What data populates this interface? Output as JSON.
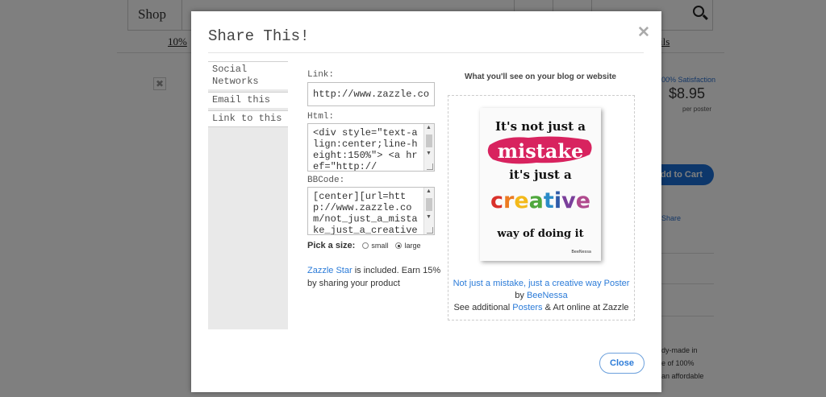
{
  "background": {
    "nav": {
      "shop": "Shop"
    },
    "promo_left": "10%",
    "promo_right": "ils",
    "satisfaction": "00% Satisfaction",
    "price": "$8.95",
    "per_poster": "per poster",
    "add_to_cart": "dd to Cart",
    "share": "Share",
    "desc_lines": [
      "dy-made in",
      "e of 100%",
      "an affordable"
    ],
    "close_glyph": "✖"
  },
  "modal": {
    "title": "Share This!",
    "close_x": "✕",
    "side_nav": [
      "Social Networks",
      "Email this",
      "Link to this"
    ],
    "link_label": "Link:",
    "link_value": "http://www.zazzle.com/",
    "html_label": "Html:",
    "html_value": "<div style=\"text-align:center;line-height:150%\"> <a href=\"http://",
    "bbcode_label": "BBCode:",
    "bbcode_value": "[center][url=http://www.zazzle.com/not_just_a_mistake_just_a_creative",
    "size": {
      "label": "Pick a size:",
      "small": "small",
      "large": "large",
      "selected": "large"
    },
    "star": {
      "link": "Zazzle Star",
      "text": "is included. Earn 15% by sharing your product"
    },
    "preview_heading": "What you'll see on your blog or website",
    "poster": {
      "line1": "It's not just a",
      "line2": "mistake",
      "line3": "it's just a",
      "line4": [
        "c",
        "r",
        "e",
        "a",
        "t",
        "i",
        "v",
        "e"
      ],
      "line5": "way of doing it",
      "signature": "BeeNessa",
      "creative_colors": [
        "#d9312b",
        "#ec7b22",
        "#f3b91a",
        "#4fa83d",
        "#2a8bc8",
        "#2f5aa8",
        "#7a3f9b",
        "#b04a8e"
      ],
      "splash_color": "#d8235f"
    },
    "caption": {
      "product_link": "Not just a mistake, just a creative way Poster",
      "by": "by",
      "author_link": "BeeNessa",
      "see_text": "See additional",
      "posters_link": "Posters",
      "tail_text": "& Art online at Zazzle"
    },
    "close_button": "Close"
  }
}
